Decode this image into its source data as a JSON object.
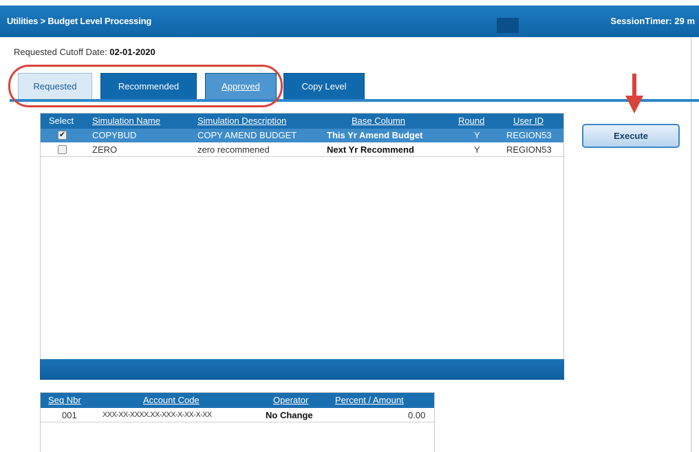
{
  "header": {
    "breadcrumb": "Utilities > Budget Level Processing",
    "session_timer": "SessionTimer: 29 m"
  },
  "cutoff": {
    "label": "Requested Cutoff Date: ",
    "value": "02-01-2020"
  },
  "tabs": [
    {
      "label": "Requested",
      "active": true
    },
    {
      "label": "Recommended",
      "active": false
    },
    {
      "label": "Approved",
      "active": false
    },
    {
      "label": "Copy Level",
      "active": false
    }
  ],
  "simulations": {
    "columns": [
      "Select",
      "Simulation Name",
      "Simulation Description",
      "Base Column",
      "Round",
      "User ID"
    ],
    "rows": [
      {
        "selected": true,
        "name": "COPYBUD",
        "description": "COPY AMEND BUDGET",
        "base_column": "This Yr Amend Budget",
        "round": "Y",
        "user_id": "REGION53"
      },
      {
        "selected": false,
        "name": "ZERO",
        "description": "zero recommened",
        "base_column": "Next Yr Recommend",
        "round": "Y",
        "user_id": "REGION53"
      }
    ]
  },
  "execute_label": "Execute",
  "accounts": {
    "columns": [
      "Seq Nbr",
      "Account Code",
      "Operator",
      "Percent / Amount"
    ],
    "rows": [
      {
        "seq": "001",
        "account_code": "XXX-XX-XXXX.XX-XXX-X-XX-X-XX",
        "operator": "No Change",
        "amount": "0.00"
      }
    ]
  },
  "colors": {
    "header_blue": "#1069ad",
    "annotation_red": "#d9433b"
  }
}
